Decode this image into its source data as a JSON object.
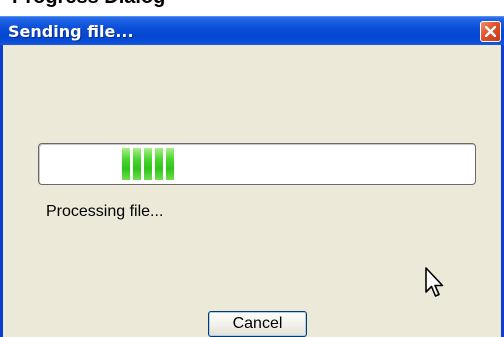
{
  "top_strip": {
    "text": "Progress Dialog"
  },
  "dialog": {
    "title": "Sending file...",
    "close_icon": "close-x-icon",
    "progress": {
      "style": "marquee",
      "block_count": 5,
      "color": "#2fc51a"
    },
    "status_text": "Processing file...",
    "cancel_label": "Cancel"
  },
  "colors": {
    "titlebar": "#0a4fd8",
    "client_background": "#ece9d8",
    "close_button": "#e2512c",
    "progress_fill": "#2fc51a"
  },
  "pointer": {
    "icon": "mouse-pointer-icon"
  }
}
